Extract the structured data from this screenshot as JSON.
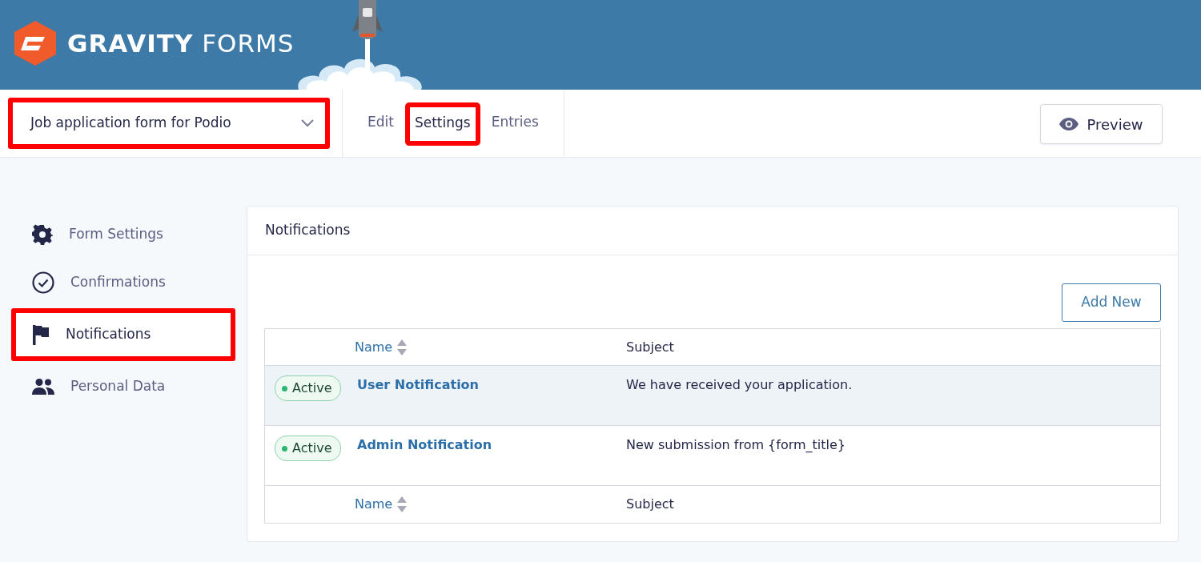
{
  "brand": {
    "name_bold": "GRAVITY",
    "name_light": "FORMS"
  },
  "form_selector": {
    "value": "Job application form for Podio",
    "annotated": true
  },
  "tabs": [
    {
      "label": "Edit",
      "selected": false,
      "annotated": false
    },
    {
      "label": "Settings",
      "selected": true,
      "annotated": true
    },
    {
      "label": "Entries",
      "selected": false,
      "annotated": false
    }
  ],
  "preview_button": "Preview",
  "sidebar": {
    "items": [
      {
        "kind": "gear",
        "label": "Form Settings",
        "selected": false,
        "annotated": false
      },
      {
        "kind": "check",
        "label": "Confirmations",
        "selected": false,
        "annotated": false
      },
      {
        "kind": "flag",
        "label": "Notifications",
        "selected": true,
        "annotated": true
      },
      {
        "kind": "people",
        "label": "Personal Data",
        "selected": false,
        "annotated": false
      }
    ]
  },
  "panel": {
    "title": "Notifications",
    "add_button": "Add New",
    "table": {
      "columns": [
        "Name",
        "Subject"
      ],
      "rows": [
        {
          "status": "Active",
          "active": true,
          "name": "User Notification",
          "subject": "We have received your application.",
          "hovered": true
        },
        {
          "status": "Active",
          "active": true,
          "name": "Admin Notification",
          "subject": "New submission from {form_title}",
          "hovered": false
        }
      ],
      "footer_columns": [
        "Name",
        "Subject"
      ]
    }
  }
}
